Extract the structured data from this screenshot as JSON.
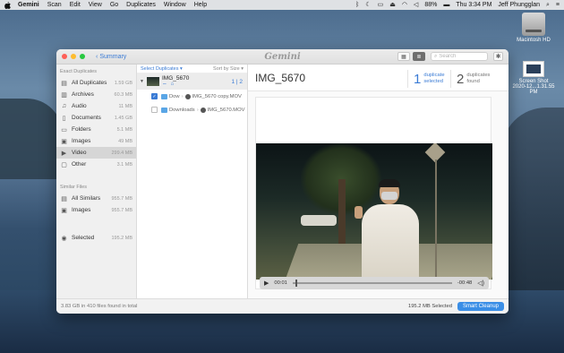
{
  "menubar": {
    "app": "Gemini",
    "items": [
      "Scan",
      "Edit",
      "View",
      "Go",
      "Duplicates",
      "Window",
      "Help"
    ],
    "battery": "88%",
    "clock": "Thu 3:34 PM",
    "user": "Jeff Phungglan"
  },
  "desktop": {
    "hd_label": "Macintosh HD",
    "shot_label": "Screen Shot",
    "shot_date": "2020-12...1.31.55 PM"
  },
  "window": {
    "back_label": "Summary",
    "logo": "Gemini",
    "search_placeholder": "Search"
  },
  "sidebar": {
    "duplicates_header": "Exact Duplicates",
    "duplicates": [
      {
        "label": "All Duplicates",
        "size": "1.59 GB"
      },
      {
        "label": "Archives",
        "size": "60.3 MB"
      },
      {
        "label": "Audio",
        "size": "11 MB"
      },
      {
        "label": "Documents",
        "size": "1.45 GB"
      },
      {
        "label": "Folders",
        "size": "5.1 MB"
      },
      {
        "label": "Images",
        "size": "49 MB"
      },
      {
        "label": "Video",
        "size": "299.4 MB"
      },
      {
        "label": "Other",
        "size": "3.1 MB"
      }
    ],
    "similar_header": "Similar Files",
    "similar": [
      {
        "label": "All Similars",
        "size": "955.7 MB"
      },
      {
        "label": "Images",
        "size": "955.7 MB"
      }
    ],
    "selected": {
      "label": "Selected",
      "size": "195.2 MB"
    }
  },
  "list": {
    "select_label": "Select Duplicates ▾",
    "sort_label": "Sort by Size ▾",
    "group": {
      "name": "IMG_5670",
      "count_selected": "1",
      "count_total": "2"
    },
    "files": [
      {
        "folder": "Dow",
        "name": "IMG_5670 copy.MOV",
        "checked": true
      },
      {
        "folder": "Downloads",
        "name": "IMG_5670.MOV",
        "checked": false
      }
    ]
  },
  "detail": {
    "title": "IMG_5670",
    "dup_selected_n": "1",
    "dup_selected_l1": "duplicate",
    "dup_selected_l2": "selected",
    "dup_found_n": "2",
    "dup_found_l1": "duplicates",
    "dup_found_l2": "found",
    "time_current": "00:01",
    "time_remaining": "-00:48",
    "playback_progress": 0.02
  },
  "footer": {
    "summary": "3.83 GB in 410 files found in total",
    "selected": "195.2 MB Selected",
    "button": "Smart Cleanup"
  },
  "colors": {
    "accent": "#3a7bd5",
    "button": "#3a8ee6"
  }
}
